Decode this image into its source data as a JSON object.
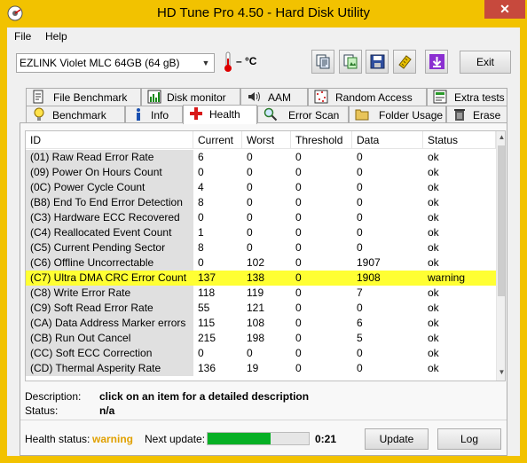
{
  "window": {
    "title": "HD Tune Pro 4.50 - Hard Disk Utility",
    "close_glyph": "✕",
    "accent_color": "#f2c200"
  },
  "menu": {
    "file": "File",
    "help": "Help"
  },
  "toolbar": {
    "drive": "EZLINK Violet MLC 64GB (64 gB)",
    "temperature": "– °C",
    "exit_label": "Exit",
    "icons": [
      "copy-text-icon",
      "copy-screenshot-icon",
      "save-icon",
      "options-icon",
      "download-icon"
    ]
  },
  "tabs_top": [
    {
      "label": "File Benchmark",
      "icon": "file-benchmark-icon"
    },
    {
      "label": "Disk monitor",
      "icon": "disk-monitor-icon"
    },
    {
      "label": "AAM",
      "icon": "speaker-icon"
    },
    {
      "label": "Random Access",
      "icon": "random-access-icon"
    },
    {
      "label": "Extra tests",
      "icon": "extra-tests-icon"
    }
  ],
  "tabs_bottom": [
    {
      "label": "Benchmark",
      "icon": "lightbulb-icon"
    },
    {
      "label": "Info",
      "icon": "info-icon"
    },
    {
      "label": "Health",
      "icon": "health-cross-icon",
      "active": true
    },
    {
      "label": "Error Scan",
      "icon": "magnifier-icon"
    },
    {
      "label": "Folder Usage",
      "icon": "folder-icon"
    },
    {
      "label": "Erase",
      "icon": "trash-icon"
    }
  ],
  "table": {
    "headers": [
      "ID",
      "Current",
      "Worst",
      "Threshold",
      "Data",
      "Status"
    ],
    "rows": [
      {
        "id": "(01) Raw Read Error Rate",
        "current": "6",
        "worst": "0",
        "threshold": "0",
        "data": "0",
        "status": "ok"
      },
      {
        "id": "(09) Power On Hours Count",
        "current": "0",
        "worst": "0",
        "threshold": "0",
        "data": "0",
        "status": "ok"
      },
      {
        "id": "(0C) Power Cycle Count",
        "current": "4",
        "worst": "0",
        "threshold": "0",
        "data": "0",
        "status": "ok"
      },
      {
        "id": "(B8) End To End Error Detection",
        "current": "8",
        "worst": "0",
        "threshold": "0",
        "data": "0",
        "status": "ok"
      },
      {
        "id": "(C3) Hardware ECC Recovered",
        "current": "0",
        "worst": "0",
        "threshold": "0",
        "data": "0",
        "status": "ok"
      },
      {
        "id": "(C4) Reallocated Event Count",
        "current": "1",
        "worst": "0",
        "threshold": "0",
        "data": "0",
        "status": "ok"
      },
      {
        "id": "(C5) Current Pending Sector",
        "current": "8",
        "worst": "0",
        "threshold": "0",
        "data": "0",
        "status": "ok"
      },
      {
        "id": "(C6) Offline Uncorrectable",
        "current": "0",
        "worst": "102",
        "threshold": "0",
        "data": "1907",
        "status": "ok"
      },
      {
        "id": "(C7) Ultra DMA CRC Error Count",
        "current": "137",
        "worst": "138",
        "threshold": "0",
        "data": "1908",
        "status": "warning",
        "highlight": true
      },
      {
        "id": "(C8) Write Error Rate",
        "current": "118",
        "worst": "119",
        "threshold": "0",
        "data": "7",
        "status": "ok"
      },
      {
        "id": "(C9) Soft Read Error Rate",
        "current": "55",
        "worst": "121",
        "threshold": "0",
        "data": "0",
        "status": "ok"
      },
      {
        "id": "(CA) Data Address Marker errors",
        "current": "115",
        "worst": "108",
        "threshold": "0",
        "data": "6",
        "status": "ok"
      },
      {
        "id": "(CB) Run Out Cancel",
        "current": "215",
        "worst": "198",
        "threshold": "0",
        "data": "5",
        "status": "ok"
      },
      {
        "id": "(CC) Soft ECC Correction",
        "current": "0",
        "worst": "0",
        "threshold": "0",
        "data": "0",
        "status": "ok"
      },
      {
        "id": "(CD) Thermal Asperity Rate",
        "current": "136",
        "worst": "19",
        "threshold": "0",
        "data": "0",
        "status": "ok"
      }
    ],
    "highlight_color": "#ffff33"
  },
  "description": {
    "label": "Description:",
    "value": "click on an item for a detailed description",
    "status_label": "Status:",
    "status_value": "n/a"
  },
  "footer": {
    "health_label": "Health status:",
    "health_value": "warning",
    "next_update_label": "Next update:",
    "progress_fraction": 0.62,
    "timer": "0:21",
    "update_label": "Update",
    "log_label": "Log"
  }
}
